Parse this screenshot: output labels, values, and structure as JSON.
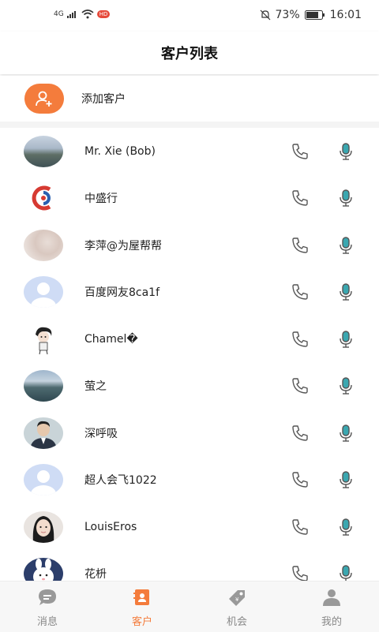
{
  "status_bar": {
    "network": "4G",
    "badge": "HD",
    "battery": "73%",
    "time": "16:01"
  },
  "header": {
    "title": "客户列表"
  },
  "add_customer": {
    "label": "添加客户"
  },
  "contacts": [
    {
      "name": "Mr. Xie (Bob)"
    },
    {
      "name": "中盛行"
    },
    {
      "name": "李萍@为屋帮帮"
    },
    {
      "name": "百度网友8ca1f"
    },
    {
      "name": "Chamel�"
    },
    {
      "name": "萤之"
    },
    {
      "name": "深呼吸"
    },
    {
      "name": "超人会飞1022"
    },
    {
      "name": "LouisEros"
    },
    {
      "name": "花枡"
    }
  ],
  "tabs": [
    {
      "label": "消息",
      "icon": "message-icon"
    },
    {
      "label": "客户",
      "icon": "contacts-icon",
      "active": true
    },
    {
      "label": "机会",
      "icon": "tag-icon"
    },
    {
      "label": "我的",
      "icon": "person-icon"
    }
  ],
  "colors": {
    "accent": "#f47c3c",
    "mic": "#3aa7b0",
    "icon_gray": "#555555"
  }
}
